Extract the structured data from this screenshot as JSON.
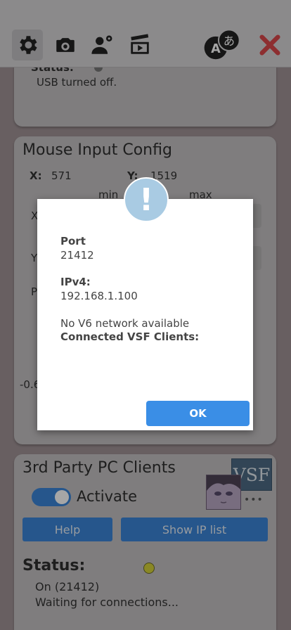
{
  "toolbar": {
    "icons": [
      "gear-icon",
      "camera-icon",
      "user-settings-icon",
      "clapperboard-icon",
      "language-icon",
      "close-icon"
    ]
  },
  "usb_card": {
    "status_label": "Status:",
    "status_text": "USB turned off."
  },
  "mouse_card": {
    "title": "Mouse Input Config",
    "x_label": "X:",
    "x_value": "571",
    "y_label": "Y:",
    "y_value": "1519",
    "min_label": "min",
    "max_label": "max",
    "row_x": "X",
    "row_y": "Y",
    "row_p": "P",
    "partial_value": "-0.6"
  },
  "dialog": {
    "icon": "!",
    "port_label": "Port",
    "port_value": "21412",
    "ipv4_label": "IPv4:",
    "ipv4_value": "192.168.1.100",
    "v6_text": "No V6 network available",
    "clients_label": "Connected VSF Clients:",
    "ok_label": "OK"
  },
  "clients_card": {
    "title": "3rd Party PC Clients",
    "toggle_label": "Activate",
    "toggle_on": true,
    "logo_text": "VSF",
    "more": "•••",
    "help_label": "Help",
    "show_ip_label": "Show IP list",
    "status_label": "Status:",
    "status_line1": "On (21412)",
    "status_line2": "Waiting for connections...",
    "status_color": "#d4d23a"
  }
}
